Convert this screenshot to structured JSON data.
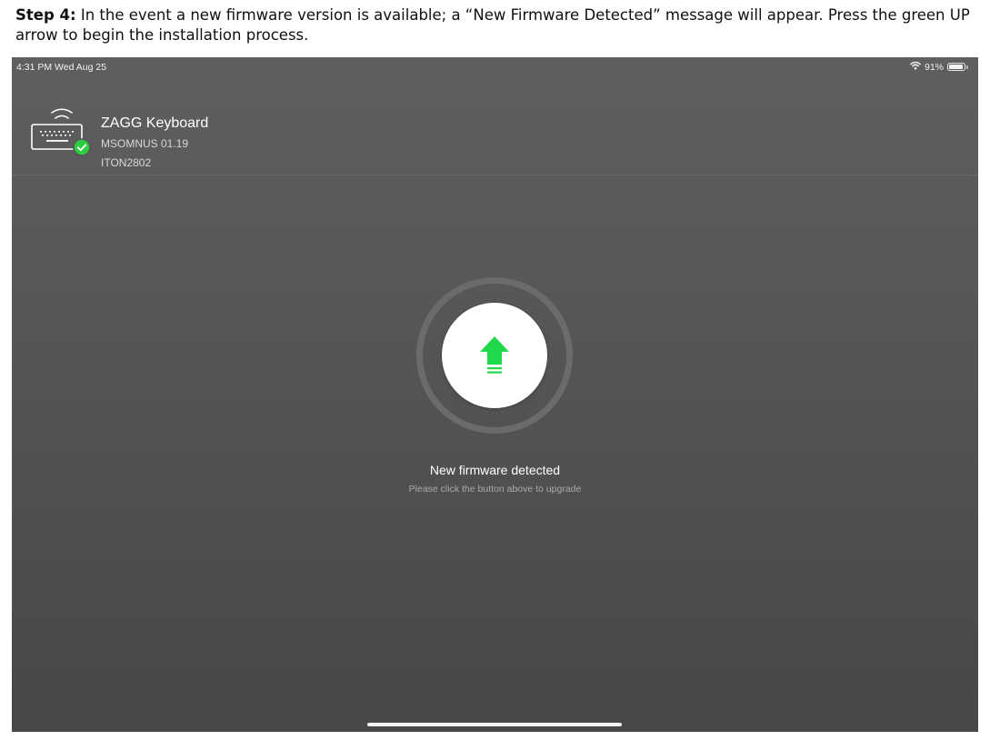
{
  "instruction": {
    "step_label": "Step 4:",
    "text": " In the event a new firmware version is available; a “New Firmware Detected” message will appear. Press the green UP arrow to begin the installation process."
  },
  "status_bar": {
    "time_date": "4:31 PM  Wed Aug 25",
    "battery_percent": "91%",
    "battery_level": 0.91,
    "icons": [
      "wifi-icon",
      "battery-icon"
    ]
  },
  "device": {
    "name": "ZAGG Keyboard",
    "model": "MSOMNUS 01.19",
    "serial": "ITON2802",
    "icons": [
      "keyboard-icon",
      "bluetooth-signal-icon",
      "connected-check-icon"
    ]
  },
  "upgrade": {
    "title": "New firmware detected",
    "subtitle": "Please click the button above to upgrade",
    "icon": "upload-arrow-icon"
  },
  "colors": {
    "accent_green": "#21d94a",
    "check_green": "#2ecc40",
    "screen_background": "#555555",
    "button_background": "#ffffff"
  }
}
